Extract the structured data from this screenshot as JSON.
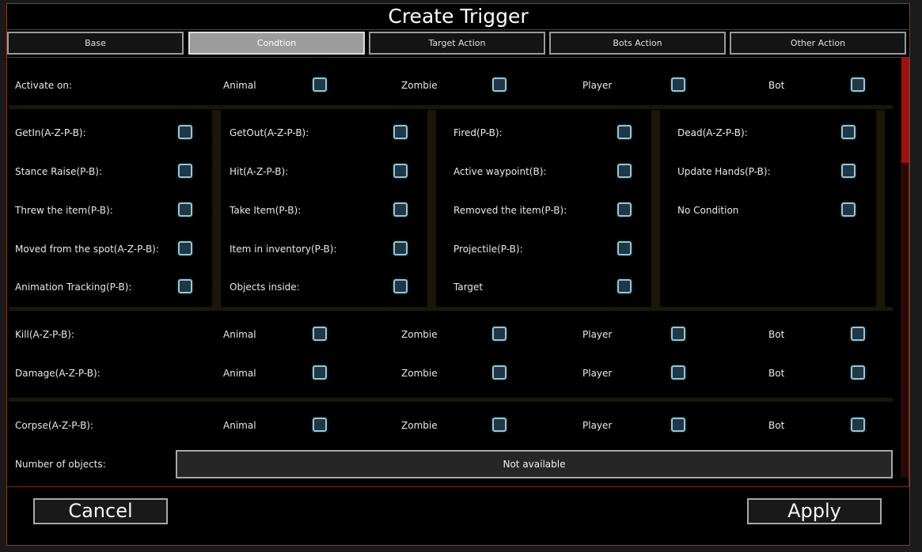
{
  "dialog": {
    "title": "Create Trigger"
  },
  "tabs": [
    {
      "label": "Base",
      "active": false
    },
    {
      "label": "Condtion",
      "active": true
    },
    {
      "label": "Target Action",
      "active": false
    },
    {
      "label": "Bots Action",
      "active": false
    },
    {
      "label": "Other Action",
      "active": false
    }
  ],
  "entity_labels": {
    "animal": "Animal",
    "zombie": "Zombie",
    "player": "Player",
    "bot": "Bot"
  },
  "activate_on": {
    "label": "Activate on:"
  },
  "conditions": {
    "getin": "GetIn(A-Z-P-B):",
    "stance_raise": "Stance Raise(P-B):",
    "threw_item": "Threw the item(P-B):",
    "moved_from_spot": "Moved from the spot(A-Z-P-B):",
    "animation_tracking": "Animation Tracking(P-B):",
    "getout": "GetOut(A-Z-P-B):",
    "hit": "Hit(A-Z-P-B):",
    "take_item": "Take Item(P-B):",
    "item_in_inventory": "Item in inventory(P-B):",
    "objects_inside": "Objects inside:",
    "fired": "Fired(P-B):",
    "active_waypoint": "Active waypoint(B):",
    "removed_item": "Removed the item(P-B):",
    "projectile": "Projectile(P-B):",
    "target": "Target",
    "dead": "Dead(A-Z-P-B):",
    "update_hands": "Update Hands(P-B):",
    "no_condition": "No Condition"
  },
  "kill": {
    "label": "Kill(A-Z-P-B):"
  },
  "damage": {
    "label": "Damage(A-Z-P-B):"
  },
  "corpse": {
    "label": "Corpse(A-Z-P-B):"
  },
  "number_of_objects": {
    "label": "Number of objects:",
    "value": "Not available"
  },
  "buttons": {
    "cancel": "Cancel",
    "apply": "Apply"
  },
  "colors": {
    "accent_border": "#8a3a1e",
    "checkbox_border": "#93c7d6",
    "scroll_thumb": "#a01010"
  }
}
